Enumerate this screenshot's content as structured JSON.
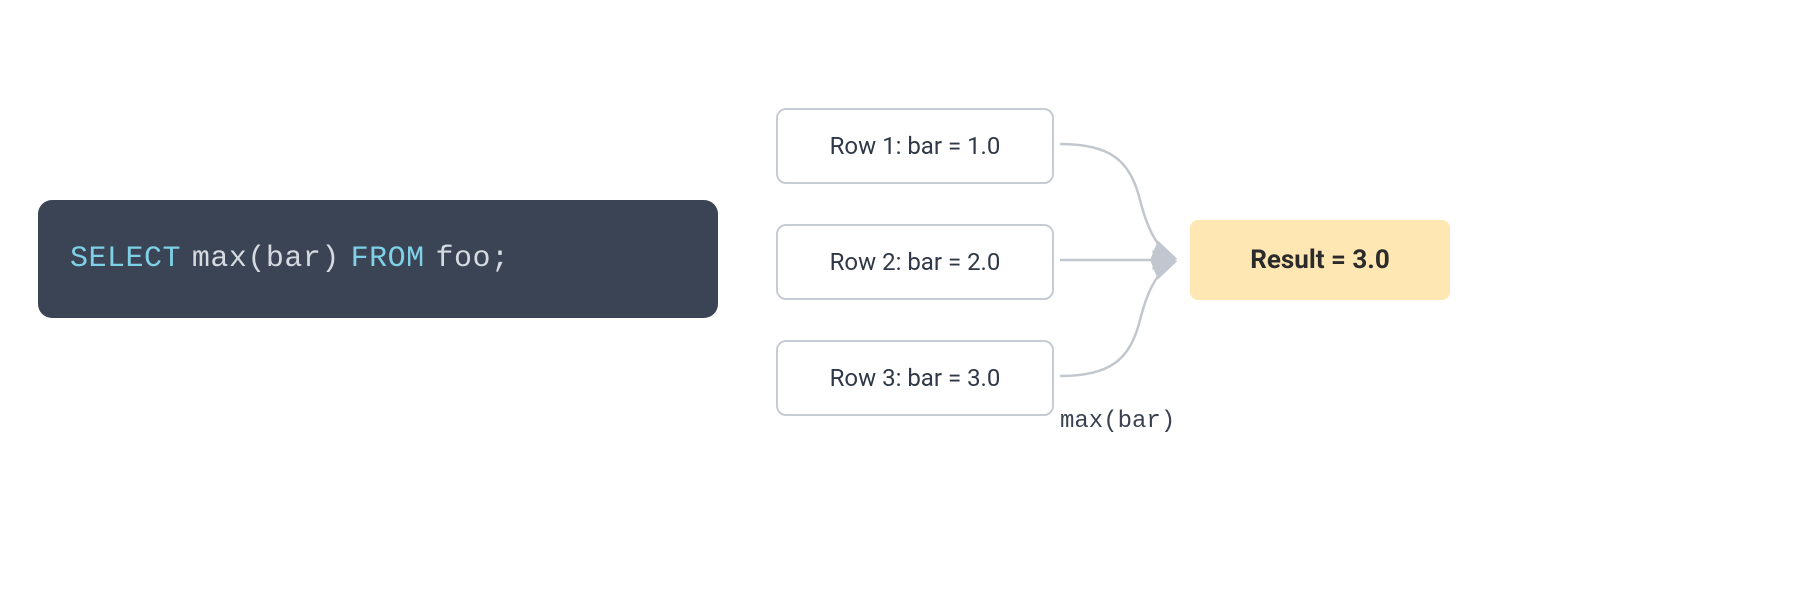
{
  "code": {
    "kw_select": "SELECT",
    "func_call": "max(bar)",
    "kw_from": "FROM",
    "table": "foo",
    "terminator": ";"
  },
  "rows": [
    {
      "label": "Row 1: bar = 1.0"
    },
    {
      "label": "Row 2: bar = 2.0"
    },
    {
      "label": "Row 3: bar = 3.0"
    }
  ],
  "aggregate_label": "max(bar)",
  "result_label": "Result = 3.0",
  "colors": {
    "code_bg": "#3b4454",
    "keyword": "#7ed1e6",
    "box_border": "#c7ccd4",
    "result_bg": "#ffe7b3",
    "arrow": "#c2c7cf"
  }
}
